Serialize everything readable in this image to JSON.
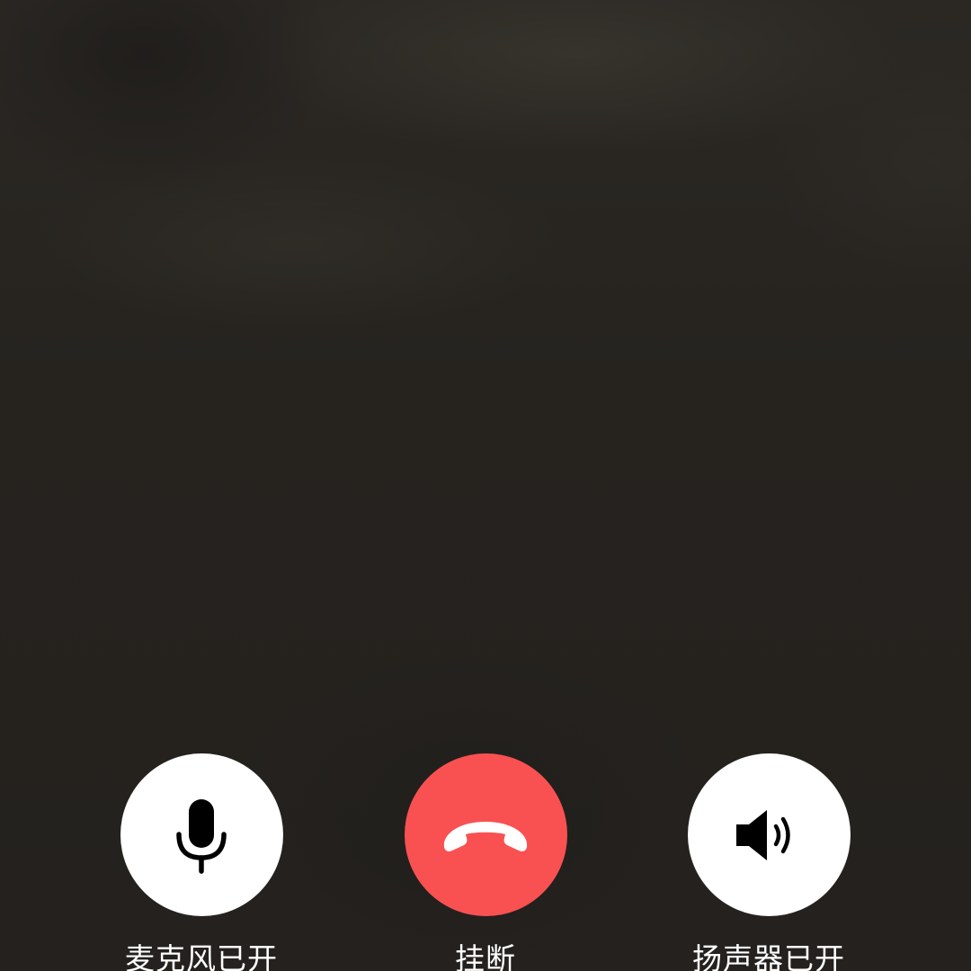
{
  "controls": {
    "microphone": {
      "label": "麦克风已开",
      "icon": "microphone-icon",
      "state": "on"
    },
    "hangup": {
      "label": "挂断",
      "icon": "phone-hangup-icon",
      "color": "#f95152"
    },
    "speaker": {
      "label": "扬声器已开",
      "icon": "speaker-icon",
      "state": "on"
    }
  },
  "colors": {
    "background": "#25221f",
    "button_white": "#ffffff",
    "hangup_red": "#f95152",
    "label_text": "#ffffff"
  }
}
